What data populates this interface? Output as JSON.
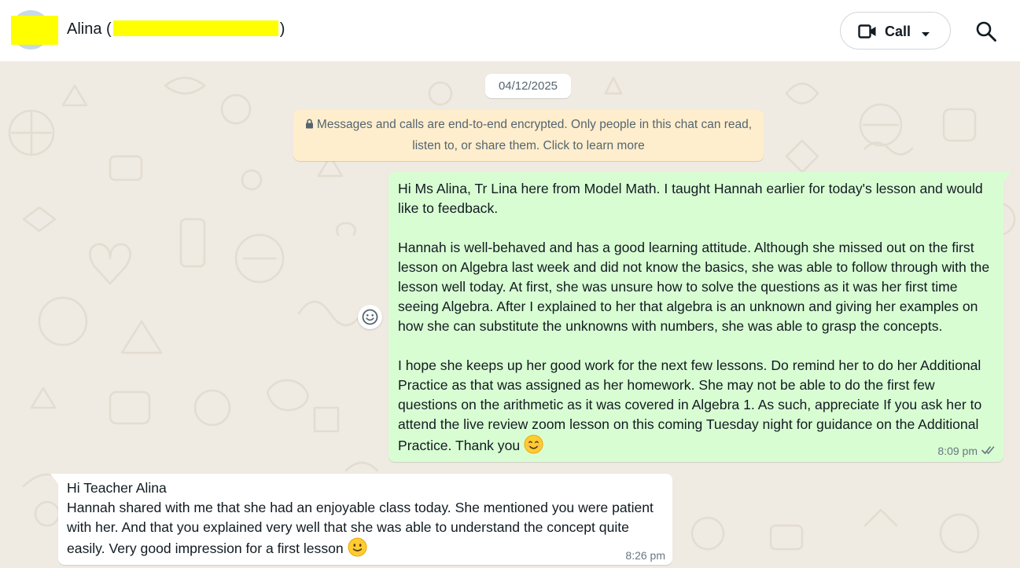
{
  "header": {
    "contact_name_prefix": "Alina (",
    "contact_name_suffix": ")",
    "call_label": "Call"
  },
  "chat": {
    "date_chip": "04/12/2025",
    "encryption_notice": "Messages and calls are end-to-end encrypted. Only people in this chat can read, listen to, or share them. Click to learn more",
    "messages": [
      {
        "direction": "outgoing",
        "text": "Hi Ms Alina, Tr Lina here from Model Math. I taught Hannah earlier for today's lesson and would like to feedback.\n\nHannah is well-behaved and has a good learning attitude. Although she missed out on the first lesson on Algebra last week and did not know the basics, she was able to follow through with the lesson well today. At first, she was unsure how to solve the questions as it was her first time seeing Algebra. After I explained to her that algebra is an unknown and giving her examples on how she can substitute the unknowns with numbers, she was able to grasp the concepts.\n\nI hope she keeps up her good work for the next few lessons. Do remind her to do her Additional Practice as that was assigned as her homework. She may not be able to do the first few questions on the arithmetic as it was covered in Algebra 1. As such, appreciate If you ask her to attend the live review zoom lesson on this coming Tuesday night for guidance on the Additional Practice. Thank you ",
        "emoji": "smiling-face-with-smiling-eyes",
        "time": "8:09 pm",
        "status": "read"
      },
      {
        "direction": "incoming",
        "text": "Hi Teacher Alina\nHannah shared with me that she had an enjoyable class today. She mentioned you were patient with her. And that you explained very well that she was able to understand the concept quite easily. Very good impression for a first lesson ",
        "emoji": "slightly-smiling-face",
        "time": "8:26 pm"
      }
    ]
  },
  "icons": {
    "video": "video-camera-icon",
    "caret": "caret-down-icon",
    "search": "search-icon",
    "lock": "lock-icon",
    "react": "emoji-react-icon",
    "ticks": "double-check-icon"
  },
  "colors": {
    "chat_bg": "#efeae2",
    "outgoing_bubble": "#d9fdd3",
    "incoming_bubble": "#ffffff",
    "notice_bg": "#ffeecd",
    "read_ticks": "#667781",
    "redaction": "#ffff00"
  }
}
